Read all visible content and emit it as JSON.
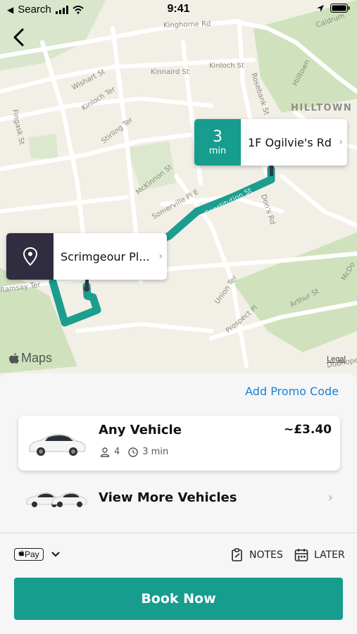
{
  "status_bar": {
    "back_app": "Search",
    "time": "9:41"
  },
  "map": {
    "streets": [
      "Kinghorne Rd",
      "Wishart St",
      "Kinloch Ter",
      "Kinnaird St",
      "Kinloch St",
      "Fingask St",
      "Stirling Ter",
      "McKinnon St",
      "Somerville Pl E",
      "Constitution St",
      "Don's Rd",
      "Rosebank St",
      "Hilltown",
      "Caldrum",
      "Union Ter",
      "Prospect Pl",
      "Arthur St",
      "Ramsay Ter",
      "McDo",
      "Dudhope"
    ],
    "district": "HILLTOWN",
    "attribution": "Maps",
    "legal": "Legal",
    "route_color": "#1b9d8f"
  },
  "destination_callout": {
    "eta_number": "3",
    "eta_unit": "min",
    "label": "1F Ogilvie's Rd",
    "color": "#169d8e"
  },
  "pickup_callout": {
    "label": "Scrimgeour Pl...",
    "color": "#2f2d3f",
    "icon": "location-pin-icon"
  },
  "sheet": {
    "promo_link": "Add Promo Code",
    "vehicle": {
      "name": "Any Vehicle",
      "price": "~£3.40",
      "seats": "4",
      "eta": "3 min"
    },
    "more_vehicles": "View More Vehicles",
    "payment": "Pay",
    "notes": "NOTES",
    "later": "LATER",
    "book_button": "Book Now"
  }
}
